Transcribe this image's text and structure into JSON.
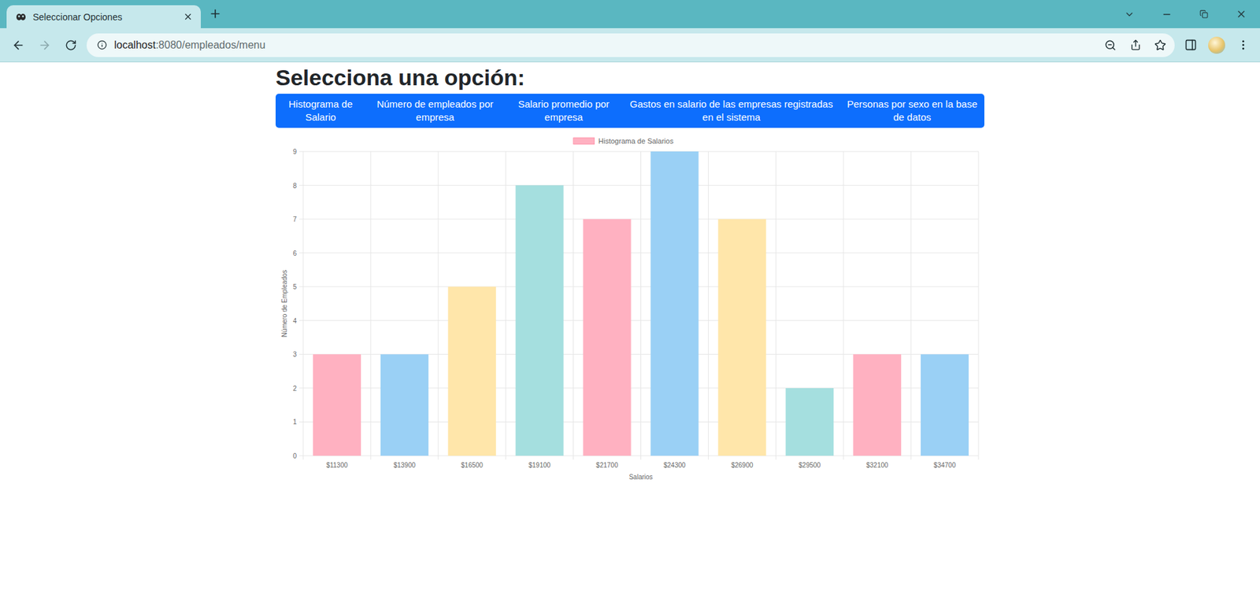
{
  "window": {
    "title": "Seleccionar Opciones"
  },
  "tabs": [
    {
      "label": "Seleccionar Opciones",
      "selected": true
    }
  ],
  "navigation": {
    "back_disabled": false,
    "forward_disabled": true
  },
  "address_bar": {
    "host": "localhost",
    "path": ":8080/empleados/menu"
  },
  "page": {
    "heading": "Selecciona una opción:",
    "menu": [
      {
        "label": "Histograma de Salario",
        "selected": false
      },
      {
        "label": "Número de empleados por empresa",
        "selected": false
      },
      {
        "label": "Salario promedio por empresa",
        "selected": false
      },
      {
        "label": "Gastos en salario de las empresas registradas en el sistema",
        "selected": false
      },
      {
        "label": "Personas por sexo en la base de datos",
        "selected": false
      }
    ]
  },
  "chart": {
    "legend": "Histograma de Salarios",
    "y_axis_title": "Número de Empleados",
    "x_axis_title": "Salarios",
    "y_ticks": [
      "0",
      "1",
      "2",
      "3",
      "4",
      "5",
      "6",
      "7",
      "8",
      "9"
    ],
    "categories": [
      "$11300",
      "$13900",
      "$16500",
      "$19100",
      "$21700",
      "$24300",
      "$26900",
      "$29500",
      "$32100",
      "$34700"
    ],
    "series": [
      {
        "name": "Histograma de Salarios",
        "values": [
          3,
          3,
          5,
          8,
          7,
          9,
          7,
          2,
          3,
          3
        ],
        "colors": [
          "#ffb1c1",
          "#9ad0f5",
          "#ffe6aa",
          "#a5dfdf",
          "#ffb1c1",
          "#9ad0f5",
          "#ffe6aa",
          "#a5dfdf",
          "#ffb1c1",
          "#9ad0f5"
        ]
      }
    ]
  }
}
